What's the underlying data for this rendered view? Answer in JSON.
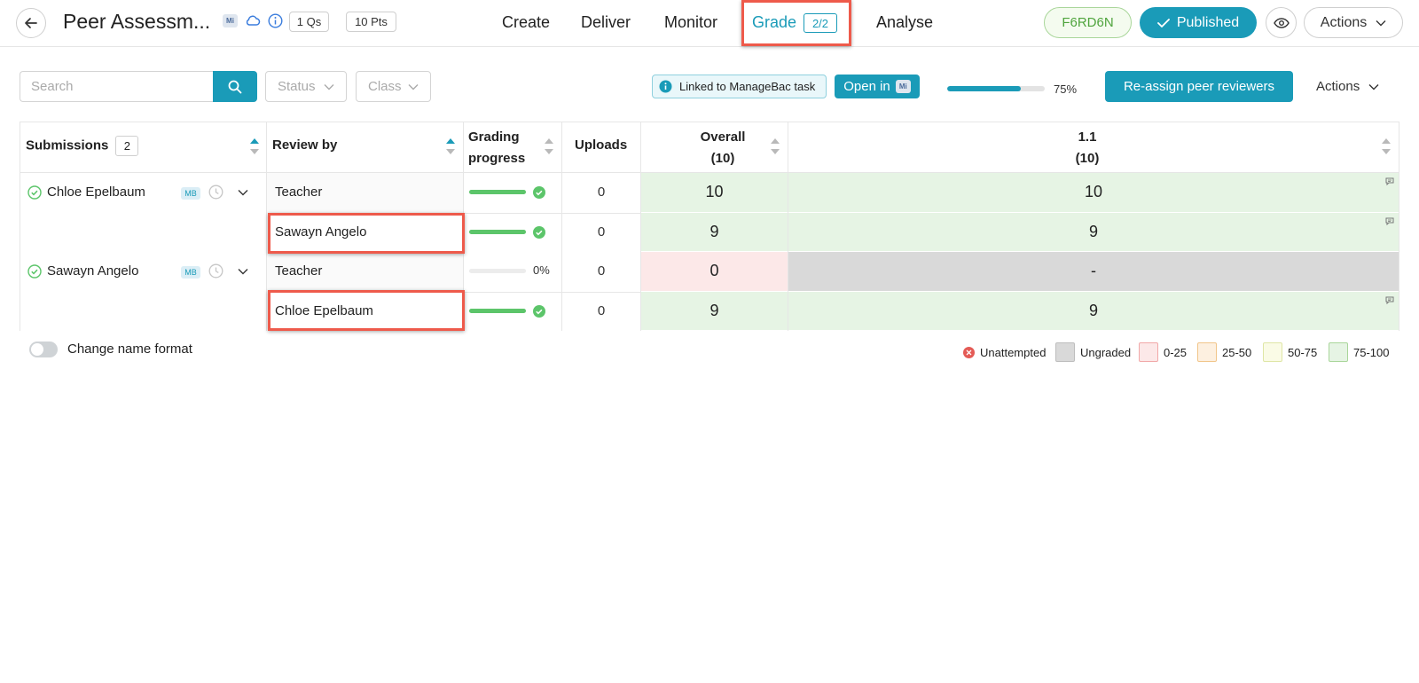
{
  "header": {
    "title": "Peer Assessm...",
    "mb_label": "Mi",
    "questions": "1 Qs",
    "points": "10 Pts",
    "nav": [
      "Create",
      "Deliver",
      "Monitor",
      "Grade",
      "Analyse"
    ],
    "active_nav": "Grade",
    "grade_count": "2/2",
    "code": "F6RD6N",
    "published_label": "Published",
    "actions_label": "Actions"
  },
  "toolbar": {
    "search_placeholder": "Search",
    "status_label": "Status",
    "class_label": "Class",
    "linked_text": "Linked to ManageBac task",
    "open_in_label": "Open in",
    "open_in_mb": "Mi",
    "progress_percent": 75,
    "progress_text": "75%",
    "reassign_label": "Re-assign peer reviewers",
    "actions_label": "Actions"
  },
  "table": {
    "headers": {
      "submissions": "Submissions",
      "submissions_count": "2",
      "review_by": "Review by",
      "grading_progress_line1": "Grading",
      "grading_progress_line2": "progress",
      "uploads": "Uploads",
      "overall_line1": "Overall",
      "overall_line2": "(10)",
      "q_line1": "1.1",
      "q_line2": "(10)"
    },
    "students": [
      {
        "name": "Chloe Epelbaum",
        "tag": "MB",
        "reviews": [
          {
            "reviewer": "Teacher",
            "progress": 100,
            "progress_text": "",
            "uploads": "0",
            "overall": "10",
            "q1": "10",
            "status": "75-100"
          },
          {
            "reviewer": "Sawayn Angelo",
            "progress": 100,
            "progress_text": "",
            "uploads": "0",
            "overall": "9",
            "q1": "9",
            "status": "75-100"
          }
        ]
      },
      {
        "name": "Sawayn Angelo",
        "tag": "MB",
        "reviews": [
          {
            "reviewer": "Teacher",
            "progress": 0,
            "progress_text": "0%",
            "uploads": "0",
            "overall": "0",
            "q1": "-",
            "status": "0-25"
          },
          {
            "reviewer": "Chloe Epelbaum",
            "progress": 100,
            "progress_text": "",
            "uploads": "0",
            "overall": "9",
            "q1": "9",
            "status": "75-100"
          }
        ]
      }
    ]
  },
  "footer": {
    "toggle_label": "Change name format",
    "legend": [
      "Unattempted",
      "Ungraded",
      "0-25",
      "25-50",
      "50-75",
      "75-100"
    ]
  },
  "colors": {
    "accent": "#1a9bb8",
    "highlight": "#ee5a4b",
    "green_cell": "#e6f4e4",
    "red_cell": "#fce8e8",
    "gray_cell": "#d9d9d9",
    "progress_green": "#5cc56a"
  }
}
